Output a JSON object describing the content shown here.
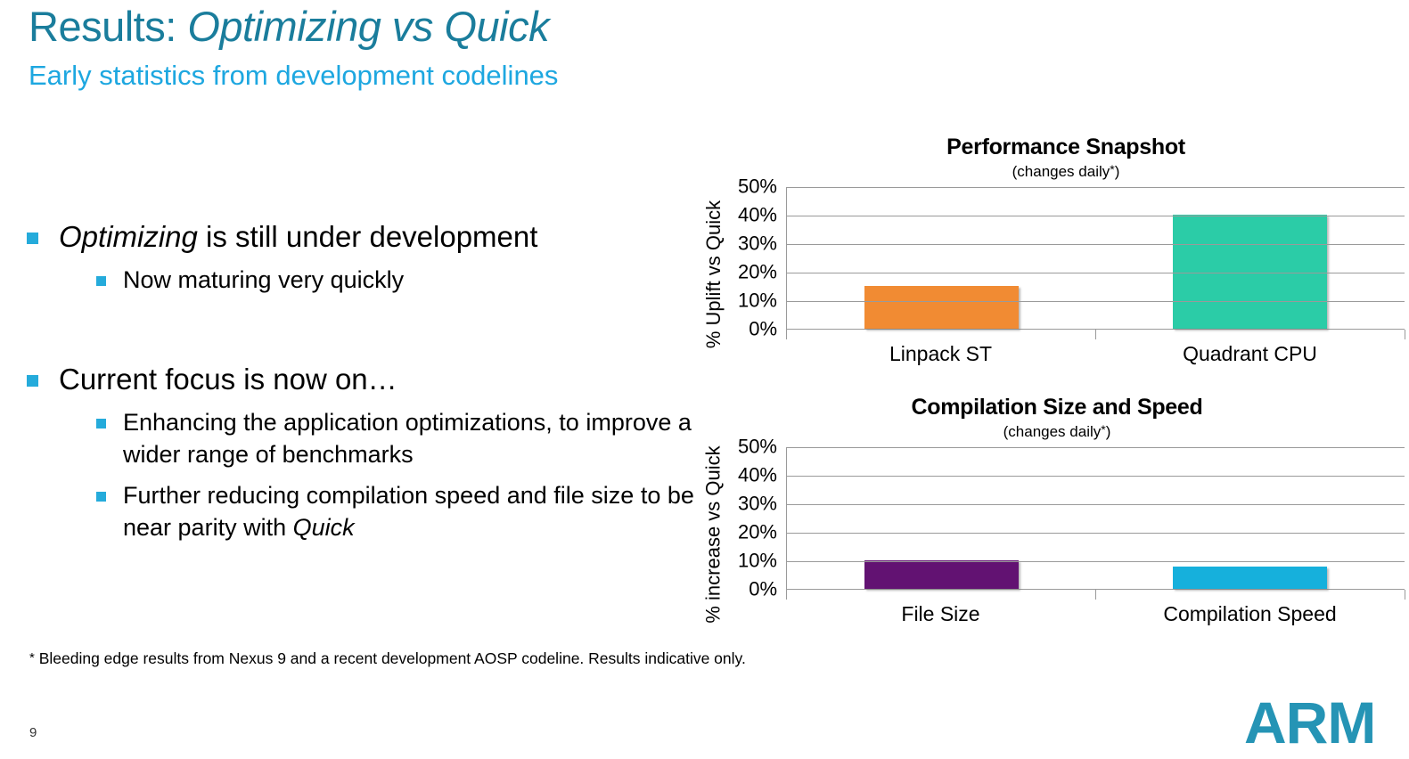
{
  "slide": {
    "title_prefix": "Results: ",
    "title_emphasis": "Optimizing vs Quick",
    "subtitle": "Early statistics from development codelines",
    "page_number": "9",
    "logo_text": "ARM",
    "footnote_marker": "*",
    "footnote": " Bleeding edge results from Nexus 9 and a recent development AOSP codeline. Results indicative only.",
    "colors": {
      "title": "#1a7d9c",
      "subtitle": "#1da7e0",
      "bullet_marker": "#25abdb",
      "logo": "#2594b5",
      "axis": "#9a9a9a"
    }
  },
  "bullets": {
    "group1": {
      "level1_pre": "",
      "level1_em": "Optimizing",
      "level1_post": " is still under development",
      "level2": [
        "Now maturing very quickly"
      ]
    },
    "group2": {
      "level1": "Current focus is now on…",
      "level2": [
        {
          "pre": "Enhancing the application optimizations, to improve a wider range of benchmarks",
          "em": "",
          "post": ""
        },
        {
          "pre": "Further reducing compilation speed and file size to be near parity with ",
          "em": "Quick",
          "post": ""
        }
      ]
    }
  },
  "chart_data": [
    {
      "id": "performance-snapshot",
      "type": "bar",
      "title": "Performance Snapshot",
      "subtitle_pre": "(changes daily",
      "subtitle_star": "*",
      "subtitle_post": ")",
      "xlabel": "",
      "ylabel": "% Uplift vs Quick",
      "categories": [
        "Linpack ST",
        "Quadrant CPU"
      ],
      "values": [
        15,
        40
      ],
      "bar_colors": [
        "#f18b33",
        "#2bcca7"
      ],
      "ylim": [
        0,
        50
      ],
      "ytick_labels": [
        "50%",
        "40%",
        "30%",
        "20%",
        "10%",
        "0%"
      ],
      "ytick_values": [
        50,
        40,
        30,
        20,
        10,
        0
      ],
      "grid": true,
      "legend": "none"
    },
    {
      "id": "compilation-size-and-speed",
      "type": "bar",
      "title": "Compilation Size and Speed",
      "subtitle_pre": "(changes daily",
      "subtitle_star": "*",
      "subtitle_post": ")",
      "xlabel": "",
      "ylabel": "% increase vs Quick",
      "categories": [
        "File Size",
        "Compilation Speed"
      ],
      "values": [
        10,
        8
      ],
      "bar_colors": [
        "#621272",
        "#16b0dc"
      ],
      "ylim": [
        0,
        50
      ],
      "ytick_labels": [
        "50%",
        "40%",
        "30%",
        "20%",
        "10%",
        "0%"
      ],
      "ytick_values": [
        50,
        40,
        30,
        20,
        10,
        0
      ],
      "grid": true,
      "legend": "none"
    }
  ]
}
